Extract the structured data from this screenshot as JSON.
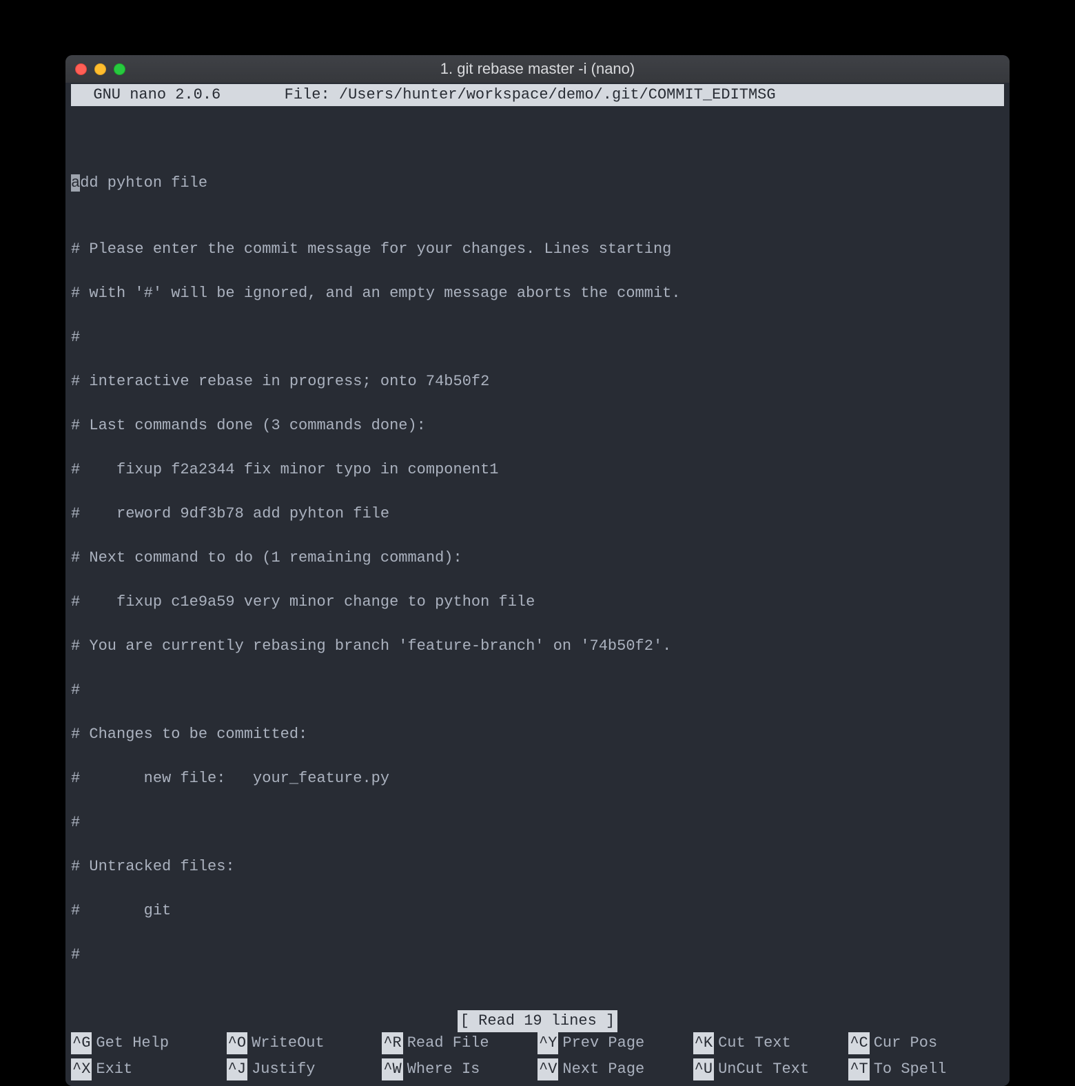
{
  "window": {
    "title": "1. git rebase master -i (nano)"
  },
  "header": {
    "app": "  GNU nano 2.0.6",
    "filelabel": "File:",
    "filepath": "/Users/hunter/workspace/demo/.git/COMMIT_EDITMSG"
  },
  "editor": {
    "cursor_char": "a",
    "first_line_rest": "dd pyhton file",
    "lines": [
      "",
      "# Please enter the commit message for your changes. Lines starting",
      "# with '#' will be ignored, and an empty message aborts the commit.",
      "#",
      "# interactive rebase in progress; onto 74b50f2",
      "# Last commands done (3 commands done):",
      "#    fixup f2a2344 fix minor typo in component1",
      "#    reword 9df3b78 add pyhton file",
      "# Next command to do (1 remaining command):",
      "#    fixup c1e9a59 very minor change to python file",
      "# You are currently rebasing branch 'feature-branch' on '74b50f2'.",
      "#",
      "# Changes to be committed:",
      "#       new file:   your_feature.py",
      "#",
      "# Untracked files:",
      "#       git",
      "#"
    ]
  },
  "status": "[ Read 19 lines ]",
  "shortcuts_row1": [
    {
      "key": "^G",
      "label": "Get Help"
    },
    {
      "key": "^O",
      "label": "WriteOut"
    },
    {
      "key": "^R",
      "label": "Read File"
    },
    {
      "key": "^Y",
      "label": "Prev Page"
    },
    {
      "key": "^K",
      "label": "Cut Text"
    },
    {
      "key": "^C",
      "label": "Cur Pos"
    }
  ],
  "shortcuts_row2": [
    {
      "key": "^X",
      "label": "Exit"
    },
    {
      "key": "^J",
      "label": "Justify"
    },
    {
      "key": "^W",
      "label": "Where Is"
    },
    {
      "key": "^V",
      "label": "Next Page"
    },
    {
      "key": "^U",
      "label": "UnCut Text"
    },
    {
      "key": "^T",
      "label": "To Spell"
    }
  ]
}
